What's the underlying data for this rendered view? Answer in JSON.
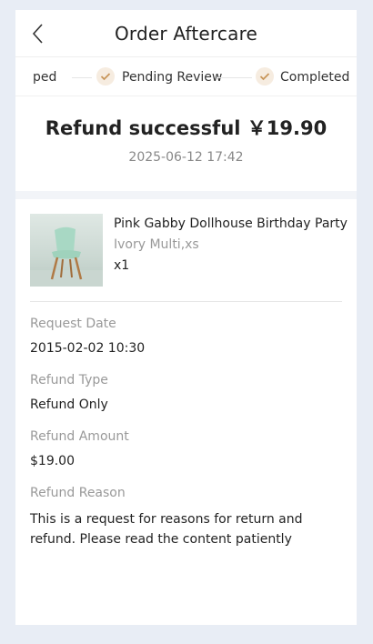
{
  "header": {
    "title": "Order Aftercare",
    "back_icon": "chevron-left-icon"
  },
  "steps": [
    {
      "label": "ped",
      "state": "done"
    },
    {
      "label": "Pending Review",
      "state": "done"
    },
    {
      "label": "Completed",
      "state": "done"
    }
  ],
  "status": {
    "title": "Refund successful  ￥19.90",
    "time": "2025-06-12 17:42"
  },
  "product": {
    "name": "Pink Gabby Dollhouse Birthday Party",
    "variant": "Ivory Multi,xs",
    "quantity": "x1"
  },
  "details": {
    "request_date_label": "Request Date",
    "request_date": "2015-02-02 10:30",
    "refund_type_label": "Refund Type",
    "refund_type": "Refund Only",
    "refund_amount_label": "Refund Amount",
    "refund_amount": "$19.00",
    "refund_reason_label": "Refund Reason",
    "refund_reason": "This is a request for reasons for return and refund. Please read the content patiently"
  },
  "colors": {
    "accent": "#c8965a",
    "check_bg": "#f6ece0",
    "page_bg": "#e8edf5"
  }
}
